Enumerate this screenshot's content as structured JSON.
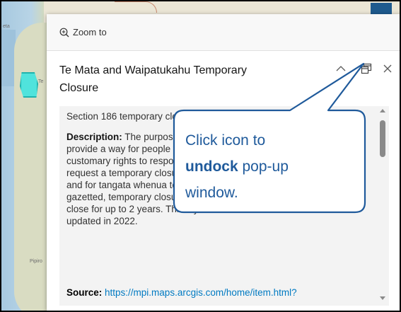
{
  "map": {
    "labels": [
      "eta",
      "Pipiro",
      "Te"
    ]
  },
  "popup": {
    "action_bar": {
      "zoom_label": "Zoom to"
    },
    "title": "Te Mata and Waipatukahu Temporary Closure",
    "icons": {
      "collapse": "chevron-up-icon",
      "dock": "undock-icon",
      "close": "close-icon"
    },
    "body": {
      "section_heading": "Section 186 temporary closures",
      "description_label": "Description:",
      "description_lines": [
        " The purpose of temporary closure restrictions is to provide a way for people who hold mana whenua in an area with customary rights to respond to the depletion of fisheries. Anyone can request a temporary closure. It was designed for customary purposes and for tangata whenua to be approved. Once approved and gazetted, temporary closures apply to everyone and fisheries can close for up to 2 years. This layer shows 11 areas and was last updated in 2022."
      ],
      "source_label": "Source:",
      "source_link": "https://mpi.maps.arcgis.com/home/item.html?"
    }
  },
  "callout": {
    "line1": "Click icon to",
    "bold_word": "undock",
    "line2_rest": " pop-up",
    "line3": "window.",
    "color": "#1f5a9b"
  }
}
